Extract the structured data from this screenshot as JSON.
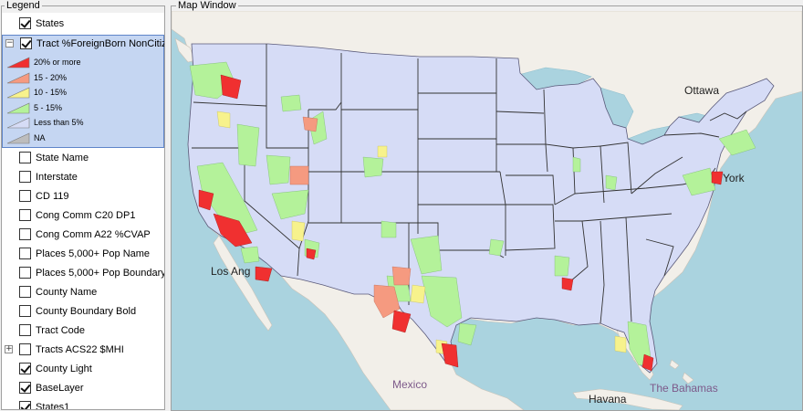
{
  "legend": {
    "title": "Legend",
    "layers": [
      {
        "name": "States",
        "checked": true
      },
      {
        "name": "Tract %ForeignBorn NonCitize",
        "checked": true,
        "expanded": true
      },
      {
        "name": "State Name",
        "checked": false
      },
      {
        "name": "Interstate",
        "checked": false
      },
      {
        "name": "CD 119",
        "checked": false
      },
      {
        "name": "Cong Comm C20 DP1",
        "checked": false
      },
      {
        "name": "Cong Comm A22 %CVAP",
        "checked": false
      },
      {
        "name": "Places 5,000+ Pop Name",
        "checked": false
      },
      {
        "name": "Places 5,000+ Pop Boundary",
        "checked": false
      },
      {
        "name": "County Name",
        "checked": false
      },
      {
        "name": "County Boundary Bold",
        "checked": false
      },
      {
        "name": "Tract Code",
        "checked": false
      },
      {
        "name": "Tracts ACS22 $MHI",
        "checked": false,
        "expandable": true
      },
      {
        "name": "County Light",
        "checked": true
      },
      {
        "name": "BaseLayer",
        "checked": true
      },
      {
        "name": "States1",
        "checked": true
      }
    ],
    "classes": [
      {
        "label": "20% or more",
        "color": "#f03030"
      },
      {
        "label": "15 - 20%",
        "color": "#f59a80"
      },
      {
        "label": "10 - 15%",
        "color": "#f7f28c"
      },
      {
        "label": "5 - 15%",
        "color": "#b4f29a"
      },
      {
        "label": "Less than 5%",
        "color": "#d6dcf6"
      },
      {
        "label": "NA",
        "color": "#bdbdbd"
      }
    ],
    "expand_collapse": "−",
    "expand_plus": "+"
  },
  "map": {
    "title": "Map Window",
    "labels": {
      "ottawa": "Ottawa",
      "york": "York",
      "los_angeles": "Los Ang",
      "mexico": "Mexico",
      "havana": "Havana",
      "bahamas": "The Bahamas"
    },
    "colors": {
      "ocean": "#aad3df",
      "land": "#f2efe9",
      "tract_fill": "#d6dcf6",
      "accent_selection": "#c5d6f2"
    }
  }
}
